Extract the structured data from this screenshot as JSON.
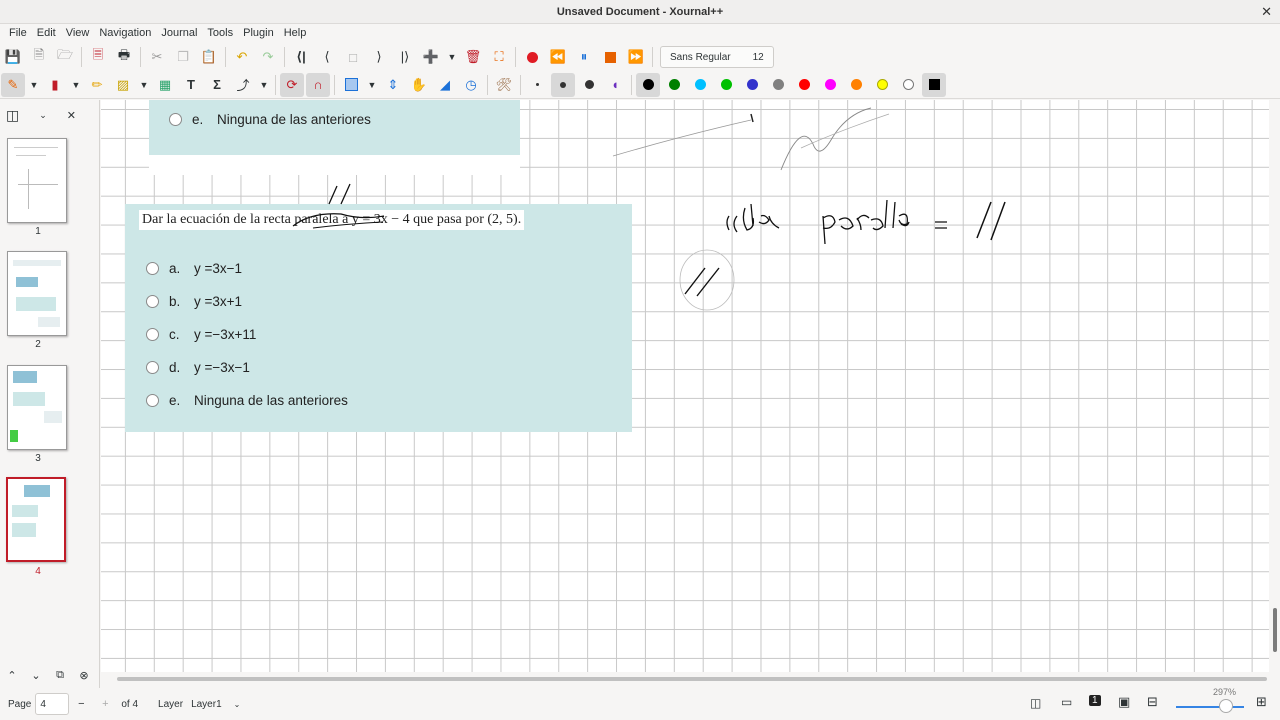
{
  "window": {
    "title": "Unsaved Document - Xournal++",
    "close": "✕"
  },
  "menu": [
    "File",
    "Edit",
    "View",
    "Navigation",
    "Journal",
    "Tools",
    "Plugin",
    "Help"
  ],
  "toolbar": {
    "font_name": "Sans Regular",
    "font_size": "12",
    "colors": [
      "#000000",
      "#008000",
      "#00c0ff",
      "#00c000",
      "#3333cc",
      "#808080",
      "#ff0000",
      "#ff00ff",
      "#ff8000",
      "#ffff00",
      "#ffffff"
    ]
  },
  "sidebar": {
    "pages": [
      {
        "label": "1"
      },
      {
        "label": "2"
      },
      {
        "label": "3"
      },
      {
        "label": "4"
      }
    ],
    "close": "✕"
  },
  "document": {
    "prev_option": {
      "letter": "e.",
      "text": "Ninguna de las anteriores"
    },
    "question": "Dar la ecuación de la recta paralela a y = 3x − 4 que pasa por (2, 5).",
    "options": [
      {
        "letter": "a.",
        "text": "y =3x−1"
      },
      {
        "letter": "b.",
        "text": "y =3x+1"
      },
      {
        "letter": "c.",
        "text": "y =−3x+11"
      },
      {
        "letter": "d.",
        "text": "y =−3x−1"
      },
      {
        "letter": "e.",
        "text": "Ninguna de las anteriores"
      }
    ],
    "handwriting": "recta paralela = //"
  },
  "status": {
    "page_label": "Page",
    "page_value": "4",
    "of_label": "of 4",
    "layer_label": "Layer",
    "layer_value": "Layer1",
    "zoom": "297%"
  }
}
